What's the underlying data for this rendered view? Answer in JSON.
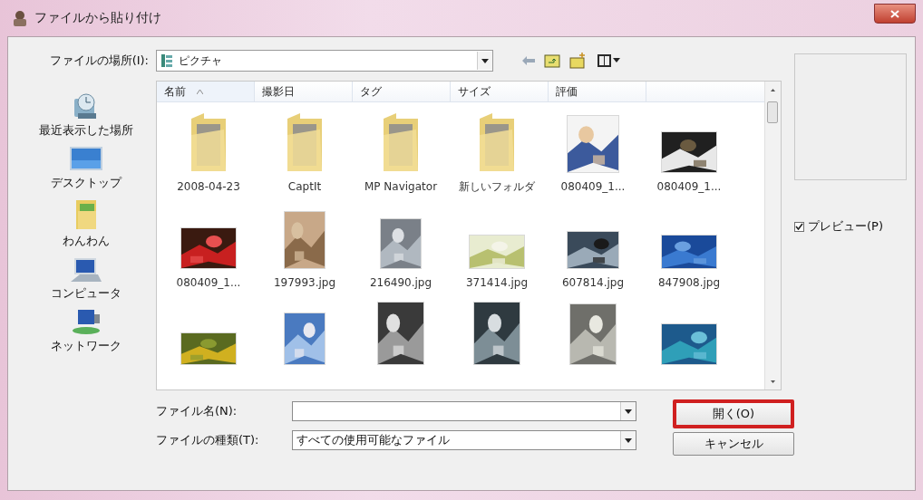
{
  "window": {
    "title": "ファイルから貼り付け"
  },
  "location": {
    "label": "ファイルの場所(I):",
    "value": "ピクチャ"
  },
  "places": [
    {
      "label": "最近表示した場所",
      "kind": "recent"
    },
    {
      "label": "デスクトップ",
      "kind": "desktop"
    },
    {
      "label": "わんわん",
      "kind": "user"
    },
    {
      "label": "コンピュータ",
      "kind": "computer"
    },
    {
      "label": "ネットワーク",
      "kind": "network"
    }
  ],
  "columns": [
    {
      "label": "名前",
      "sorted": true
    },
    {
      "label": "撮影日",
      "sorted": false
    },
    {
      "label": "タグ",
      "sorted": false
    },
    {
      "label": "サイズ",
      "sorted": false
    },
    {
      "label": "評価",
      "sorted": false
    }
  ],
  "files": [
    {
      "name": "2008-04-23",
      "kind": "folder"
    },
    {
      "name": "CaptIt",
      "kind": "folder"
    },
    {
      "name": "MP Navigator",
      "kind": "folder"
    },
    {
      "name": "新しいフォルダ",
      "kind": "folder"
    },
    {
      "name": "080409_1...",
      "kind": "picture"
    },
    {
      "name": "080409_1...",
      "kind": "picture"
    },
    {
      "name": "080409_1...",
      "kind": "picture"
    },
    {
      "name": "197993.jpg",
      "kind": "picture"
    },
    {
      "name": "216490.jpg",
      "kind": "picture"
    },
    {
      "name": "371414.jpg",
      "kind": "picture"
    },
    {
      "name": "607814.jpg",
      "kind": "picture"
    },
    {
      "name": "847908.jpg",
      "kind": "picture"
    },
    {
      "kind": "picture"
    },
    {
      "kind": "picture"
    },
    {
      "kind": "picture"
    },
    {
      "kind": "picture"
    },
    {
      "kind": "picture"
    },
    {
      "kind": "picture"
    }
  ],
  "file_name": {
    "label": "ファイル名(N):"
  },
  "file_type": {
    "label": "ファイルの種類(T):",
    "value": "すべての使用可能なファイル"
  },
  "buttons": [
    {
      "label": "開く(O)",
      "highlighted": true
    },
    {
      "label": "キャンセル",
      "highlighted": false
    }
  ],
  "preview": {
    "label": "プレビュー(P)",
    "checked": true
  }
}
